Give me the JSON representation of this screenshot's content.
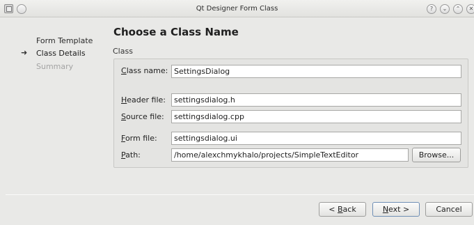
{
  "window": {
    "title": "Qt Designer Form Class",
    "controls": [
      "help-icon",
      "minimize-icon",
      "maximize-icon",
      "close-icon"
    ],
    "control_glyphs": {
      "help": "?",
      "minimize": "⌄",
      "maximize": "⌃",
      "close": "✕"
    }
  },
  "steps": {
    "items": [
      {
        "label": "Form Template",
        "state": "done"
      },
      {
        "label": "Class Details",
        "state": "current"
      },
      {
        "label": "Summary",
        "state": "future"
      }
    ],
    "current_marker": "➜"
  },
  "page": {
    "title": "Choose a Class Name",
    "group_title": "Class"
  },
  "form": {
    "class_name": {
      "label_key": "C",
      "label_rest": "lass name:",
      "value": "SettingsDialog"
    },
    "header_file": {
      "label_key": "H",
      "label_rest": "eader file:",
      "value": "settingsdialog.h"
    },
    "source_file": {
      "label_key": "S",
      "label_rest": "ource file:",
      "value": "settingsdialog.cpp"
    },
    "form_file": {
      "label_key": "F",
      "label_rest": "orm file:",
      "value": "settingsdialog.ui"
    },
    "path": {
      "label_key": "P",
      "label_rest": "ath:",
      "value": "/home/alexchmykhalo/projects/SimpleTextEditor"
    },
    "browse_label": "Browse..."
  },
  "buttons": {
    "back_prefix": "< ",
    "back_key": "B",
    "back_rest": "ack",
    "next_key": "N",
    "next_rest": "ext >",
    "cancel": "Cancel"
  },
  "colors": {
    "background": "#e9e9e7",
    "input_bg": "#ffffff",
    "default_button_border": "#6f8fb5"
  }
}
